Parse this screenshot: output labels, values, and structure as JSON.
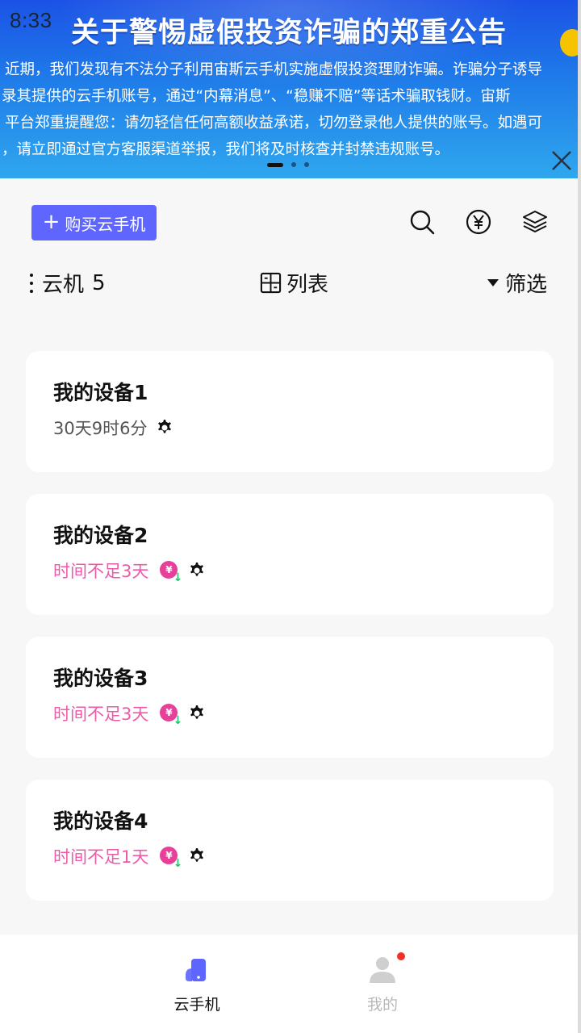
{
  "status_bar": {
    "time": "8:33"
  },
  "banner": {
    "title": "关于警惕虚假投资诈骗的郑重公告",
    "lines": [
      "近期，我们发现有不法分子利用宙斯云手机实施虚假投资理财诈骗。诈骗分子诱导",
      "录其提供的云手机账号，通过“内幕消息”、“稳赚不赔”等话术骗取钱财。宙斯",
      "平台郑重提醒您：请勿轻信任何高额收益承诺，切勿登录他人提供的账号。如遇可",
      "，请立即通过官方客服渠道举报，我们将及时核查并封禁违规账号。"
    ],
    "page_count": 3,
    "active_page": 1
  },
  "toolbar": {
    "buy_label": "购买云手机",
    "icons": [
      "search-icon",
      "yuan-coin-icon",
      "layers-icon"
    ]
  },
  "filter_row": {
    "cloud_label": "云机",
    "cloud_count": "5",
    "list_label": "列表",
    "filter_label": "筛选"
  },
  "devices": [
    {
      "name": "我的设备1",
      "status": "30天9时6分",
      "low_time": false
    },
    {
      "name": "我的设备2",
      "status": "时间不足3天",
      "low_time": true
    },
    {
      "name": "我的设备3",
      "status": "时间不足3天",
      "low_time": true
    },
    {
      "name": "我的设备4",
      "status": "时间不足1天",
      "low_time": true
    }
  ],
  "bottom_nav": {
    "items": [
      {
        "label": "云手机",
        "icon": "cloud-phone-icon",
        "active": true
      },
      {
        "label": "我的",
        "icon": "user-icon",
        "active": false,
        "has_badge": true
      }
    ]
  },
  "colors": {
    "accent": "#5f66ff",
    "low_time": "#ef5aa8",
    "badge": "#f0302a"
  }
}
